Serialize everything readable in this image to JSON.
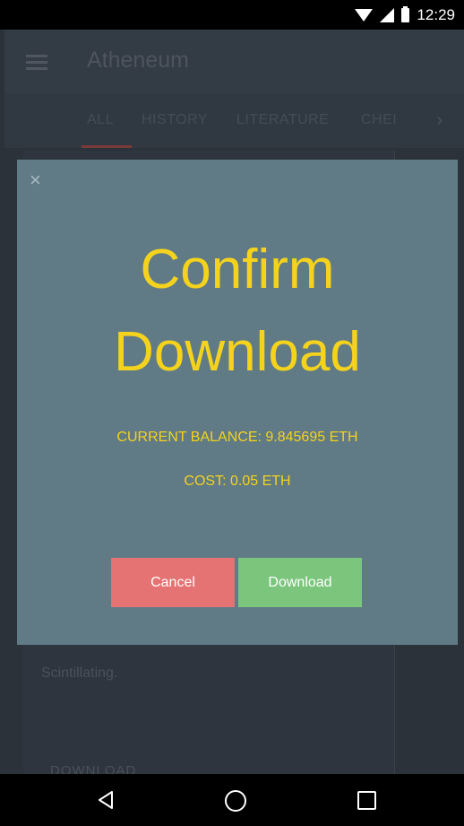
{
  "status_bar": {
    "time": "12:29",
    "icons": [
      "wifi-icon",
      "signal-icon",
      "battery-icon"
    ]
  },
  "app_bar": {
    "title": "Atheneum",
    "menu_icon": "hamburger-icon"
  },
  "tabs": [
    {
      "label": "ALL",
      "selected": true
    },
    {
      "label": "HISTORY",
      "selected": false
    },
    {
      "label": "LITERATURE",
      "selected": false
    },
    {
      "label": "CHEI",
      "selected": false
    }
  ],
  "background_card": {
    "text": "Scintillating.",
    "action_label": "DOWNLOAD"
  },
  "modal": {
    "close_symbol": "×",
    "title_line_1": "Confirm",
    "title_line_2": "Download",
    "balance_text": "CURRENT BALANCE: 9.845695 ETH",
    "cost_text": "COST: 0.05 ETH",
    "cancel_label": "Cancel",
    "download_label": "Download"
  },
  "colors": {
    "accent_yellow": "#f5d31c",
    "modal_bg": "#607b86",
    "cancel": "#e57373",
    "download": "#7cc57d"
  }
}
